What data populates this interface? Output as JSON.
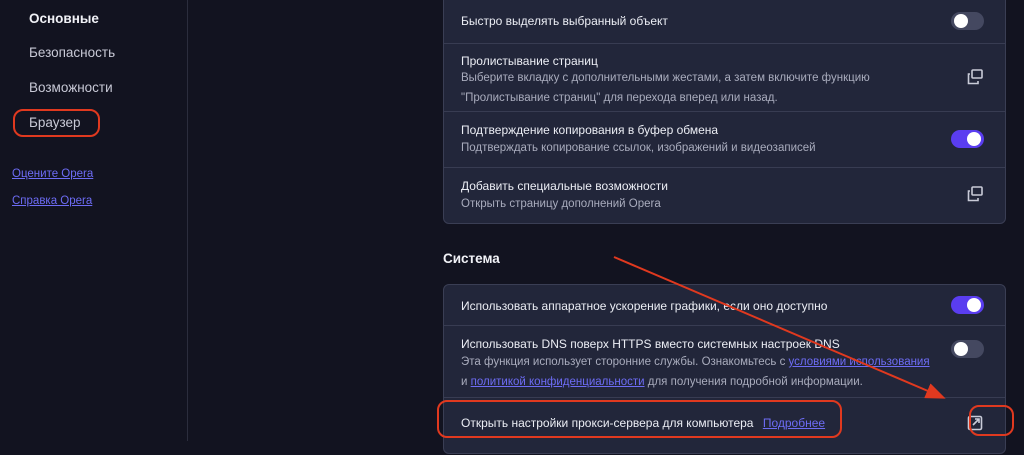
{
  "sidebar": {
    "items": [
      {
        "label": "Основные",
        "active": true
      },
      {
        "label": "Безопасность",
        "active": false
      },
      {
        "label": "Возможности",
        "active": false
      },
      {
        "label": "Браузер",
        "active": false
      }
    ],
    "links": [
      {
        "label": "Оцените Opera"
      },
      {
        "label": "Справка Opera"
      }
    ]
  },
  "accessibility_panel": {
    "rows": [
      {
        "title": "Быстро выделять выбранный объект",
        "control": "toggle",
        "state": "off"
      },
      {
        "title": "Пролистывание страниц",
        "desc": "Выберите вкладку с дополнительными жестами, а затем включите функцию \"Пролистывание страниц\" для перехода вперед или назад.",
        "control": "external-link-icon"
      },
      {
        "title": "Подтверждение копирования в буфер обмена",
        "desc": "Подтверждать копирование ссылок, изображений и видеозаписей",
        "control": "toggle",
        "state": "on"
      },
      {
        "title": "Добавить специальные возможности",
        "desc": "Открыть страницу дополнений Opera",
        "control": "external-link-icon"
      }
    ]
  },
  "system": {
    "title": "Система",
    "rows": [
      {
        "title": "Использовать аппаратное ускорение графики, если оно доступно",
        "control": "toggle",
        "state": "on"
      },
      {
        "title": "Использовать DNS поверх HTTPS вместо системных настроек DNS",
        "desc_part1": "Эта функция использует сторонние службы. Ознакомьтесь с",
        "desc_link1": "условиями использования",
        "desc_part2": "и",
        "desc_link2": "политикой конфиденциальности",
        "desc_part3": "для получения подробной информации.",
        "control": "toggle",
        "state": "off"
      },
      {
        "title": "Открыть настройки прокси-сервера для компьютера",
        "link": "Подробнее",
        "control": "open-external-icon"
      }
    ]
  },
  "colors": {
    "background": "#121320",
    "panel": "#22263a",
    "accent_toggle_on": "#5a3df0",
    "link": "#6d6cf5",
    "annotation_red": "#e0391f"
  }
}
